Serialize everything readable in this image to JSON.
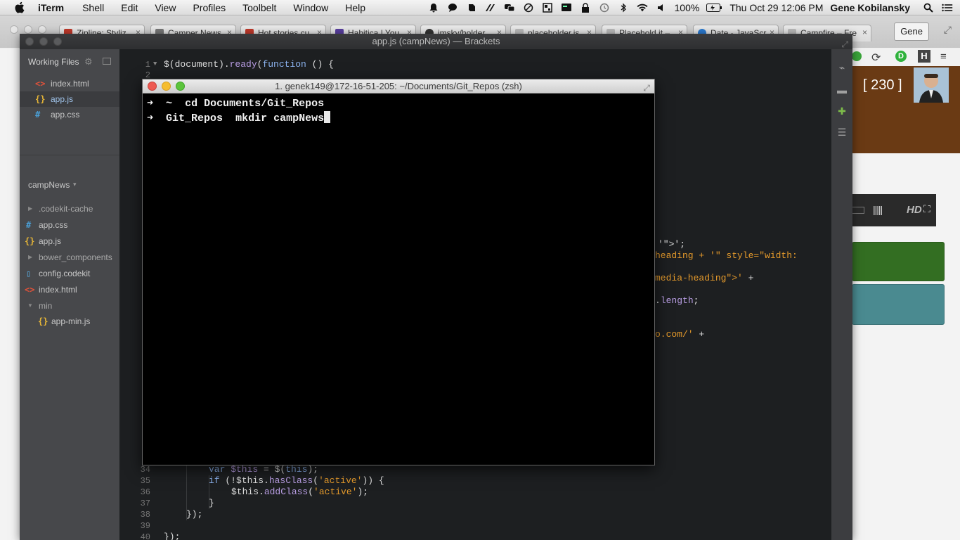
{
  "menubar": {
    "app_name": "iTerm",
    "items": [
      "Shell",
      "Edit",
      "View",
      "Profiles",
      "Toolbelt",
      "Window",
      "Help"
    ],
    "battery": "100%",
    "datetime": "Thu Oct 29  12:06 PM",
    "user": "Gene Kobilansky"
  },
  "browser": {
    "tabs": [
      {
        "label": "Zipline: Styliz",
        "color": "#c0392b"
      },
      {
        "label": "Camper News",
        "color": "#666666"
      },
      {
        "label": "Hot stories cu",
        "color": "#c0392b"
      },
      {
        "label": "Habitica | You",
        "color": "#5a3fa0"
      },
      {
        "label": "imsky/holder",
        "color": "#333333"
      },
      {
        "label": "placeholder.js",
        "color": "#999999"
      },
      {
        "label": "Placehold.it –",
        "color": "#999999"
      },
      {
        "label": "Date - JavaScr",
        "color": "#2b7bd1"
      },
      {
        "label": "Campfire – Fre",
        "color": "#999999"
      }
    ],
    "profile_button": "Gene",
    "page": {
      "badge": "[ 230 ]",
      "video_hd": "HD"
    }
  },
  "brackets": {
    "title": "app.js (campNews) — Brackets",
    "working_files_label": "Working Files",
    "working_files": [
      {
        "name": "index.html",
        "type": "html"
      },
      {
        "name": "app.js",
        "type": "js"
      },
      {
        "name": "app.css",
        "type": "css"
      }
    ],
    "project_name": "campNews",
    "tree": [
      {
        "name": ".codekit-cache",
        "kind": "folder"
      },
      {
        "name": "app.css",
        "kind": "css"
      },
      {
        "name": "app.js",
        "kind": "js"
      },
      {
        "name": "bower_components",
        "kind": "folder"
      },
      {
        "name": "config.codekit",
        "kind": "doc"
      },
      {
        "name": "index.html",
        "kind": "html"
      },
      {
        "name": "min",
        "kind": "folder-open"
      },
      {
        "name": "app-min.js",
        "kind": "js"
      }
    ],
    "line_numbers": {
      "l1": "1",
      "l2": "2",
      "l34": "34",
      "l35": "35",
      "l36": "36",
      "l37": "37",
      "l38": "38",
      "l39": "39",
      "l40": "40"
    },
    "code": {
      "line1": {
        "a": "$(document).",
        "b": "ready",
        "c": "(",
        "d": "function",
        "e": " () {"
      },
      "frag1": "'\">';",
      "frag2a": "heading",
      "frag2b": " + '\" style=\"width:",
      "frag3a": "media-heading\">'",
      "frag3b": " +",
      "frag4a": ".",
      "frag4b": "length",
      "frag4c": ";",
      "frag5a": "o.com/'",
      "frag5b": " +",
      "line34": {
        "a": "var",
        "b": " $this",
        "c": " = $(",
        "d": "this",
        "e": ");"
      },
      "line35": {
        "a": "if",
        "b": " (!$this.",
        "c": "hasClass",
        "d": "(",
        "e": "'active'",
        "f": ")) {"
      },
      "line36": {
        "a": "$this.",
        "b": "addClass",
        "c": "(",
        "d": "'active'",
        "e": ");"
      },
      "line37": "}",
      "line38": "});",
      "line40": "});"
    }
  },
  "iterm": {
    "title": "1. genek149@172-16-51-205: ~/Documents/Git_Repos (zsh)",
    "lines": [
      {
        "prompt": "➜",
        "dir": "~",
        "command": "cd Documents/Git_Repos"
      },
      {
        "prompt": "➜",
        "dir": "Git_Repos",
        "command": "mkdir campNews"
      }
    ]
  }
}
